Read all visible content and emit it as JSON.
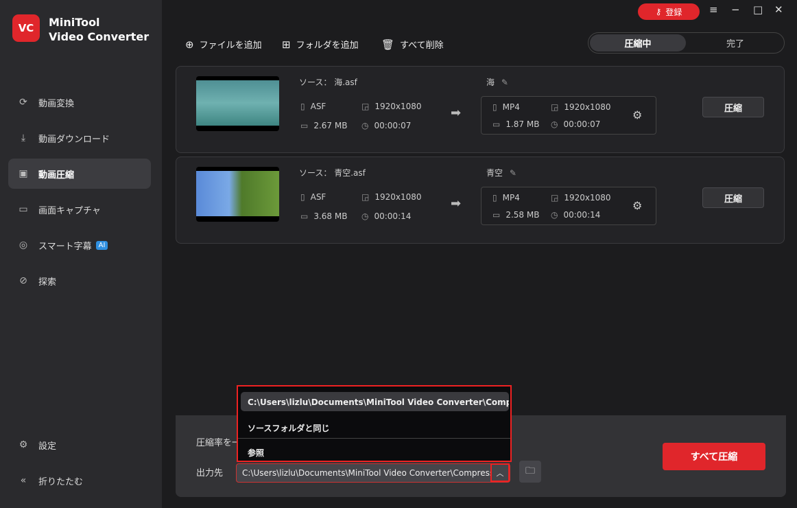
{
  "app": {
    "logo": "VC",
    "name_line1": "MiniTool",
    "name_line2": "Video Converter"
  },
  "sidebar": {
    "items": [
      {
        "label": "動画変換",
        "icon": "convert-icon"
      },
      {
        "label": "動画ダウンロード",
        "icon": "download-icon"
      },
      {
        "label": "動画圧縮",
        "icon": "compress-icon"
      },
      {
        "label": "画面キャプチャ",
        "icon": "camera-icon"
      },
      {
        "label": "スマート字幕",
        "icon": "subtitle-icon",
        "badge": "AI"
      },
      {
        "label": "探索",
        "icon": "compass-icon"
      }
    ],
    "settings": "設定",
    "collapse": "折りたたむ"
  },
  "titlebar": {
    "register": "登録"
  },
  "toolbar": {
    "add_file": "ファイルを追加",
    "add_folder": "フォルダを追加",
    "delete_all": "すべて削除"
  },
  "tabs": {
    "compressing": "圧縮中",
    "done": "完了"
  },
  "files": [
    {
      "source_label": "ソース：",
      "source": "海.asf",
      "format": "ASF",
      "resolution": "1920x1080",
      "size": "2.67 MB",
      "duration": "00:00:07",
      "out_name": "海",
      "out_format": "MP4",
      "out_resolution": "1920x1080",
      "out_size": "1.87 MB",
      "out_duration": "00:00:07",
      "button": "圧縮"
    },
    {
      "source_label": "ソース：",
      "source": "青空.asf",
      "format": "ASF",
      "resolution": "1920x1080",
      "size": "3.68 MB",
      "duration": "00:00:14",
      "out_name": "青空",
      "out_format": "MP4",
      "out_resolution": "1920x1080",
      "out_size": "2.58 MB",
      "out_duration": "00:00:14",
      "button": "圧縮"
    }
  ],
  "bottom": {
    "ratio_label": "圧縮率を一",
    "output_label": "出力先",
    "output_path": "C:\\Users\\lizlu\\Documents\\MiniTool Video Converter\\Compressed",
    "compress_all": "すべて圧縮"
  },
  "dropdown": {
    "options": [
      "C:\\Users\\lizlu\\Documents\\MiniTool Video Converter\\Compressed",
      "ソースフォルダと同じ",
      "参照"
    ]
  }
}
